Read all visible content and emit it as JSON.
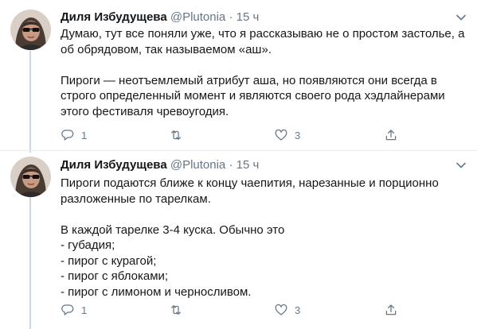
{
  "tweets": [
    {
      "author": {
        "name": "Диля Избудущева",
        "handle": "@Plutonia",
        "dot": "·",
        "time": "15 ч"
      },
      "paragraphs": [
        "Думаю, тут все поняли уже, что я рассказываю не о простом застолье, а об обрядовом, так называемом «аш».",
        "Пироги — неотъемлемый атрибут аша, но появляются они всегда в строго определенный момент и являются своего рода хэдлайнерами этого фестиваля чревоугодия."
      ],
      "replies": "1",
      "retweets": "",
      "likes": "3"
    },
    {
      "author": {
        "name": "Диля Избудущева",
        "handle": "@Plutonia",
        "dot": "·",
        "time": "15 ч"
      },
      "paragraphs": [
        "Пироги подаются ближе к концу чаепития, нарезанные и порционно разложенные по тарелкам.",
        "В каждой тарелке 3-4 куска. Обычно это\n- губадия;\n- пирог с курагой;\n- пирог с яблоками;\n- пирог с лимоном и черносливом."
      ],
      "replies": "1",
      "retweets": "",
      "likes": "3"
    }
  ],
  "icons": {
    "reply": "reply-icon",
    "retweet": "retweet-icon",
    "like": "heart-icon",
    "share": "share-icon",
    "caret": "chevron-down-icon"
  }
}
